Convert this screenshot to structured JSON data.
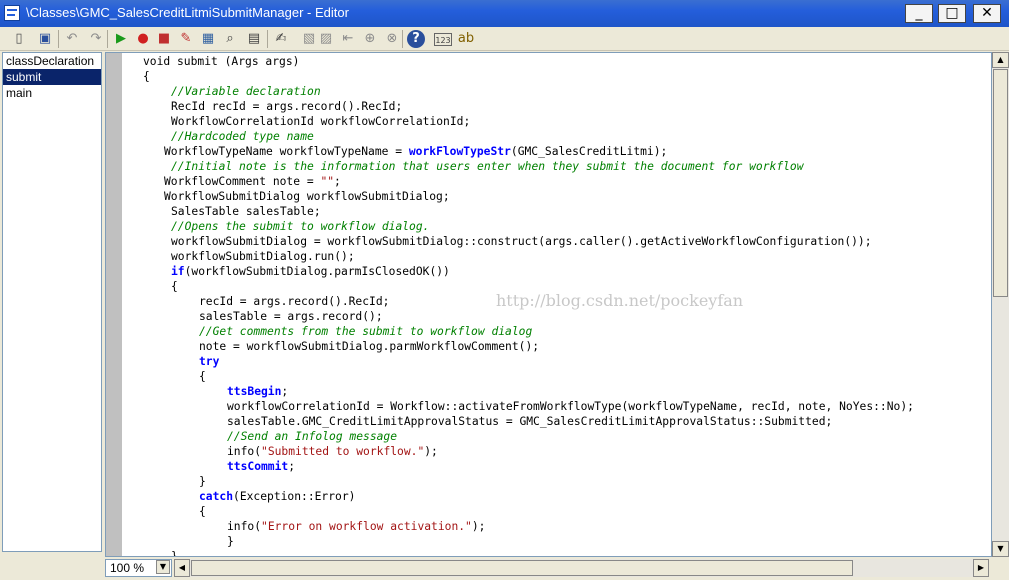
{
  "window": {
    "title": "\\Classes\\GMC_SalesCreditLitmiSubmitManager - Editor",
    "minimize_icon": "minimize-icon",
    "maximize_icon": "maximize-icon",
    "close_icon": "close-icon",
    "minimize_glyph": "_",
    "maximize_glyph": "□",
    "close_glyph": "✕"
  },
  "toolbar": {
    "buttons": [
      {
        "icon": "new-icon",
        "glyph": "▯",
        "color": "#555555"
      },
      {
        "icon": "save-icon",
        "glyph": "▣",
        "color": "#2a4f9c"
      },
      {
        "icon": "undo-icon",
        "glyph": "↶",
        "color": "#8c8c8c"
      },
      {
        "icon": "redo-icon",
        "glyph": "↷",
        "color": "#8c8c8c"
      },
      {
        "icon": "run-icon",
        "glyph": "▶",
        "color": "#1a9a1a"
      },
      {
        "icon": "breakpoint-icon",
        "glyph": "●",
        "color": "#d02020"
      },
      {
        "icon": "remove-breakpoints-icon",
        "glyph": "■",
        "color": "#c03030"
      },
      {
        "icon": "toggle-breakpoint-icon",
        "glyph": "✎",
        "color": "#c03030"
      },
      {
        "icon": "compile-icon",
        "glyph": "▦",
        "color": "#3060a0"
      },
      {
        "icon": "lookup-icon",
        "glyph": "⌕",
        "color": "#404040"
      },
      {
        "icon": "properties-icon",
        "glyph": "▤",
        "color": "#404040"
      },
      {
        "icon": "script-icon",
        "glyph": "✍",
        "color": "#404040"
      },
      {
        "icon": "comment-icon",
        "glyph": "▧",
        "color": "#8c8c8c"
      },
      {
        "icon": "uncomment-icon",
        "glyph": "▨",
        "color": "#8c8c8c"
      },
      {
        "icon": "indent-icon",
        "glyph": "⇤",
        "color": "#8c8c8c"
      },
      {
        "icon": "find-icon",
        "glyph": "⊕",
        "color": "#8c8c8c"
      },
      {
        "icon": "replace-icon",
        "glyph": "⊗",
        "color": "#8c8c8c"
      },
      {
        "icon": "help-icon",
        "glyph": "?",
        "color": "#ffffff"
      },
      {
        "icon": "line-numbers-icon",
        "glyph": "123",
        "color": "#404040"
      },
      {
        "icon": "code-style-icon",
        "glyph": "ab",
        "color": "#806000"
      }
    ]
  },
  "methods": [
    {
      "label": "classDeclaration",
      "selected": false
    },
    {
      "label": "submit",
      "selected": true
    },
    {
      "label": "main",
      "selected": false
    }
  ],
  "code_lines": [
    {
      "indent": 0,
      "spans": [
        {
          "t": "void submit (Args args)",
          "c": "plain"
        }
      ]
    },
    {
      "indent": 0,
      "spans": [
        {
          "t": "{",
          "c": "plain"
        }
      ]
    },
    {
      "indent": 4,
      "spans": [
        {
          "t": "//Variable declaration",
          "c": "cm"
        }
      ]
    },
    {
      "indent": 4,
      "spans": [
        {
          "t": "RecId recId = args.record().RecId;",
          "c": "plain"
        }
      ]
    },
    {
      "indent": 4,
      "spans": [
        {
          "t": "WorkflowCorrelationId workflowCorrelationId;",
          "c": "plain"
        }
      ]
    },
    {
      "indent": 4,
      "spans": [
        {
          "t": "//Hardcoded type name",
          "c": "cm"
        }
      ]
    },
    {
      "indent": 3,
      "spans": [
        {
          "t": "WorkflowTypeName workflowTypeName = ",
          "c": "plain"
        },
        {
          "t": "workFlowTypeStr",
          "c": "kw"
        },
        {
          "t": "(GMC_SalesCreditLitmi);",
          "c": "plain"
        }
      ]
    },
    {
      "indent": 4,
      "spans": [
        {
          "t": "//Initial note is the information that users enter when they submit the document for workflow",
          "c": "cm"
        }
      ]
    },
    {
      "indent": 3,
      "spans": [
        {
          "t": "WorkflowComment note = ",
          "c": "plain"
        },
        {
          "t": "\"\"",
          "c": "st"
        },
        {
          "t": ";",
          "c": "plain"
        }
      ]
    },
    {
      "indent": 3,
      "spans": [
        {
          "t": "WorkflowSubmitDialog workflowSubmitDialog;",
          "c": "plain"
        }
      ]
    },
    {
      "indent": 4,
      "spans": [
        {
          "t": "SalesTable salesTable;",
          "c": "plain"
        }
      ]
    },
    {
      "indent": 4,
      "spans": [
        {
          "t": "//Opens the submit to workflow dialog.",
          "c": "cm"
        }
      ]
    },
    {
      "indent": 4,
      "spans": [
        {
          "t": "workflowSubmitDialog = workflowSubmitDialog::construct(args.caller().getActiveWorkflowConfiguration());",
          "c": "plain"
        }
      ]
    },
    {
      "indent": 4,
      "spans": [
        {
          "t": "workflowSubmitDialog.run();",
          "c": "plain"
        }
      ]
    },
    {
      "indent": 4,
      "spans": [
        {
          "t": "if",
          "c": "kw"
        },
        {
          "t": "(workflowSubmitDialog.parmIsClosedOK())",
          "c": "plain"
        }
      ]
    },
    {
      "indent": 4,
      "spans": [
        {
          "t": "{",
          "c": "plain"
        }
      ]
    },
    {
      "indent": 8,
      "spans": [
        {
          "t": "recId = args.record().RecId;",
          "c": "plain"
        }
      ]
    },
    {
      "indent": 8,
      "spans": [
        {
          "t": "salesTable = args.record();",
          "c": "plain"
        }
      ]
    },
    {
      "indent": 8,
      "spans": [
        {
          "t": "//Get comments from the submit to workflow dialog",
          "c": "cm"
        }
      ]
    },
    {
      "indent": 8,
      "spans": [
        {
          "t": "note = workflowSubmitDialog.parmWorkflowComment();",
          "c": "plain"
        }
      ]
    },
    {
      "indent": 8,
      "spans": [
        {
          "t": "try",
          "c": "kw"
        }
      ]
    },
    {
      "indent": 8,
      "spans": [
        {
          "t": "{",
          "c": "plain"
        }
      ]
    },
    {
      "indent": 12,
      "spans": [
        {
          "t": "ttsBegin",
          "c": "kw"
        },
        {
          "t": ";",
          "c": "plain"
        }
      ]
    },
    {
      "indent": 12,
      "spans": [
        {
          "t": "workflowCorrelationId = Workflow::activateFromWorkflowType(workflowTypeName, recId, note, NoYes::No);",
          "c": "plain"
        }
      ]
    },
    {
      "indent": 12,
      "spans": [
        {
          "t": "salesTable.GMC_CreditLimitApprovalStatus = GMC_SalesCreditLimitApprovalStatus::Submitted;",
          "c": "plain"
        }
      ]
    },
    {
      "indent": 12,
      "spans": [
        {
          "t": "//Send an Infolog message",
          "c": "cm"
        }
      ]
    },
    {
      "indent": 12,
      "spans": [
        {
          "t": "info(",
          "c": "plain"
        },
        {
          "t": "\"Submitted to workflow.\"",
          "c": "st"
        },
        {
          "t": ");",
          "c": "plain"
        }
      ]
    },
    {
      "indent": 12,
      "spans": [
        {
          "t": "ttsCommit",
          "c": "kw"
        },
        {
          "t": ";",
          "c": "plain"
        }
      ]
    },
    {
      "indent": 8,
      "spans": [
        {
          "t": "}",
          "c": "plain"
        }
      ]
    },
    {
      "indent": 8,
      "spans": [
        {
          "t": "catch",
          "c": "kw"
        },
        {
          "t": "(Exception::Error)",
          "c": "plain"
        }
      ]
    },
    {
      "indent": 8,
      "spans": [
        {
          "t": "{",
          "c": "plain"
        }
      ]
    },
    {
      "indent": 12,
      "spans": [
        {
          "t": "info(",
          "c": "plain"
        },
        {
          "t": "\"Error on workflow activation.\"",
          "c": "st"
        },
        {
          "t": ");",
          "c": "plain"
        }
      ]
    },
    {
      "indent": 12,
      "spans": [
        {
          "t": "}",
          "c": "plain"
        }
      ]
    },
    {
      "indent": 4,
      "spans": [
        {
          "t": "}",
          "c": "plain"
        }
      ]
    }
  ],
  "watermark": "http://blog.csdn.net/pockeyfan",
  "statusbar": {
    "zoom": "100 %"
  },
  "scroll": {
    "vertical_position": 0.0,
    "horizontal_position": 0.0
  },
  "icons": {
    "up_arrow": "▲",
    "down_arrow": "▼",
    "left_arrow": "◀",
    "right_arrow": "▶",
    "zoom_dropdown": "▼"
  },
  "colors": {
    "title_bar": "#245edb",
    "selection": "#0a246a",
    "comment": "#008000",
    "keyword": "#0000ff",
    "string": "#a31515"
  }
}
